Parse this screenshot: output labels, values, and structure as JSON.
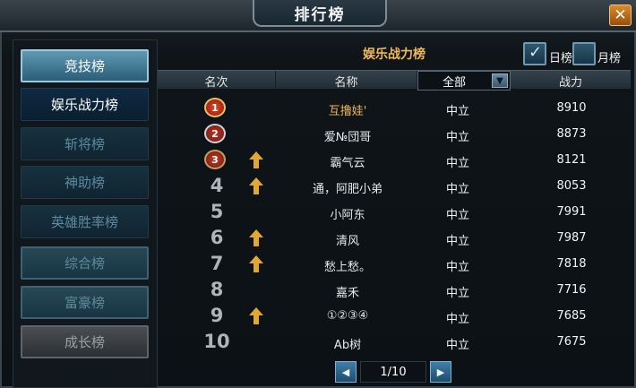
{
  "window": {
    "title": "排行榜",
    "close_label": "✕"
  },
  "sidebar": {
    "items": [
      {
        "label": "竞技榜"
      },
      {
        "label": "娱乐战力榜"
      },
      {
        "label": "斩将榜"
      },
      {
        "label": "神助榜"
      },
      {
        "label": "英雄胜率榜"
      },
      {
        "label": "综合榜"
      },
      {
        "label": "富豪榜"
      },
      {
        "label": "成长榜"
      }
    ]
  },
  "main": {
    "list_title": "娱乐战力榜",
    "daily": {
      "label": "日榜",
      "checked": true
    },
    "monthly": {
      "label": "月榜",
      "checked": false
    },
    "columns": {
      "rank": "名次",
      "name": "名称",
      "faction_select": "全部",
      "power": "战力"
    },
    "rows": [
      {
        "rank": "1",
        "name": "互撸娃'",
        "faction": "中立",
        "power": "8910",
        "up": false
      },
      {
        "rank": "2",
        "name": "爱№団哥",
        "faction": "中立",
        "power": "8873",
        "up": false
      },
      {
        "rank": "3",
        "name": "霸气云",
        "faction": "中立",
        "power": "8121",
        "up": true
      },
      {
        "rank": "4",
        "name": "通，阿肥小弟",
        "faction": "中立",
        "power": "8053",
        "up": true
      },
      {
        "rank": "5",
        "name": "小阿东",
        "faction": "中立",
        "power": "7991",
        "up": false
      },
      {
        "rank": "6",
        "name": "清风",
        "faction": "中立",
        "power": "7987",
        "up": true
      },
      {
        "rank": "7",
        "name": "愁上愁。",
        "faction": "中立",
        "power": "7818",
        "up": true
      },
      {
        "rank": "8",
        "name": "嘉禾",
        "faction": "中立",
        "power": "7716",
        "up": false
      },
      {
        "rank": "9",
        "name": "①②③④",
        "faction": "中立",
        "power": "7685",
        "up": true
      },
      {
        "rank": "10",
        "name": "Ab树",
        "faction": "中立",
        "power": "7675",
        "up": false
      }
    ],
    "pager": {
      "text": "1/10",
      "prev": "◀",
      "next": "▶"
    }
  },
  "colors": {
    "first_place_name": "#f0b85a",
    "accent_orange": "#d98a2a"
  }
}
